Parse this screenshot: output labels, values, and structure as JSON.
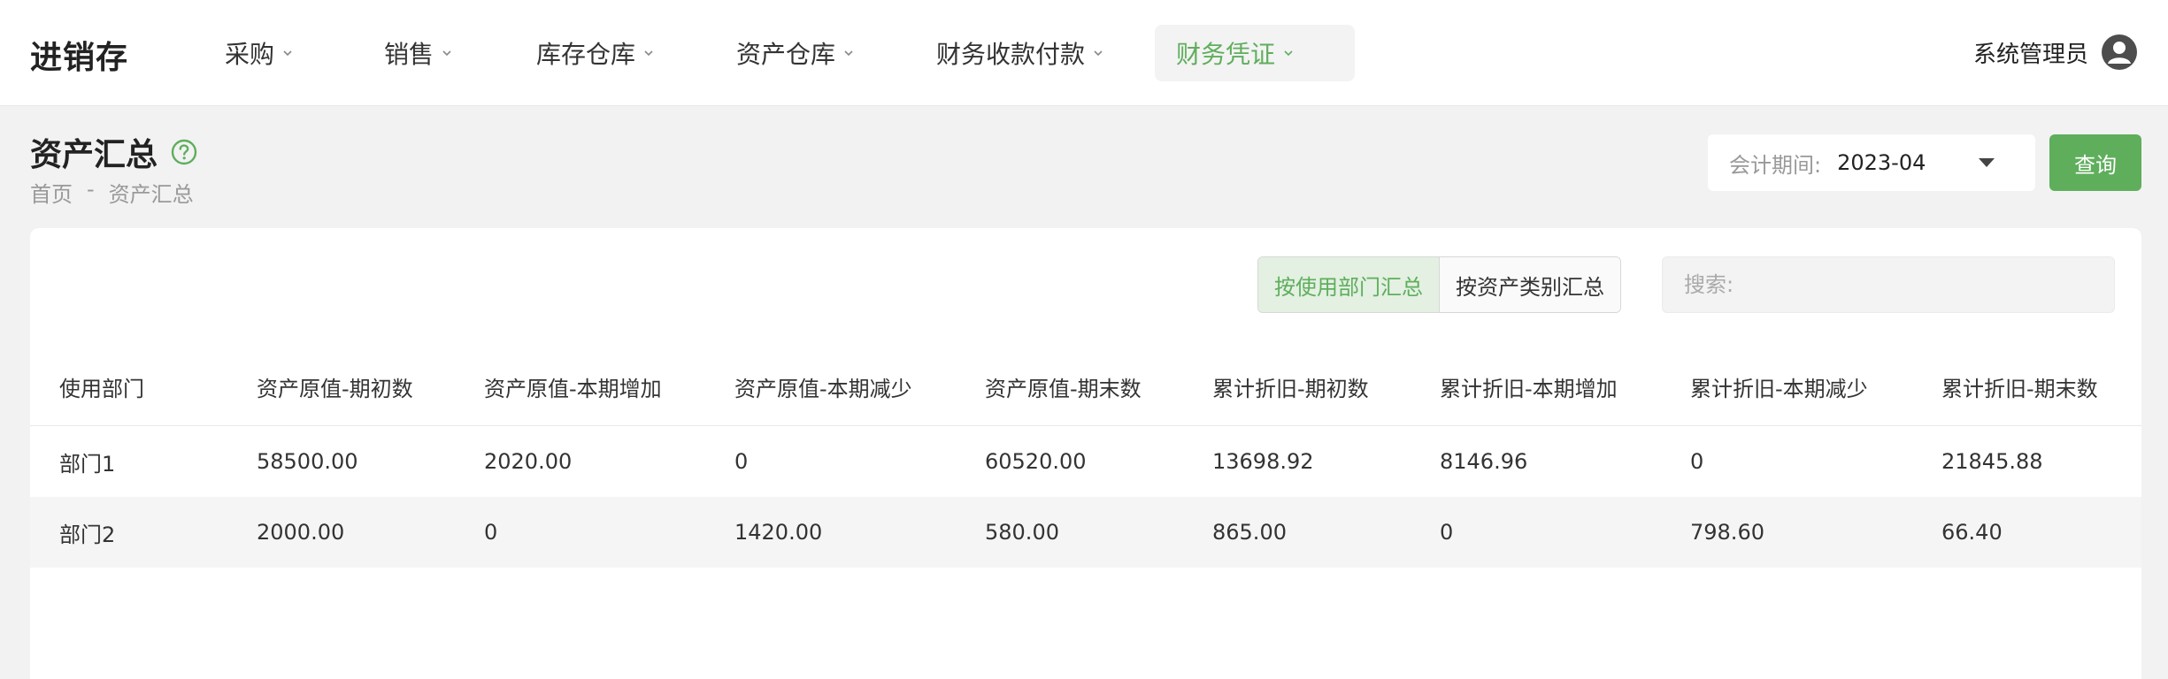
{
  "app": {
    "brand": "进销存"
  },
  "nav": {
    "items": [
      {
        "label": "采购"
      },
      {
        "label": "销售"
      },
      {
        "label": "库存仓库"
      },
      {
        "label": "资产仓库"
      },
      {
        "label": "财务收款付款"
      },
      {
        "label": "财务凭证"
      }
    ],
    "active_index": 5
  },
  "user": {
    "name": "系统管理员",
    "icon": "user-avatar-icon"
  },
  "page": {
    "title": "资产汇总",
    "help_icon": "question-circle-icon",
    "breadcrumb": {
      "home": "首页",
      "sep": "-",
      "current": "资产汇总"
    }
  },
  "filters": {
    "period_label": "会计期间:",
    "period_value": "2023-04",
    "query_label": "查询"
  },
  "toolbar": {
    "by_department": "按使用部门汇总",
    "by_category": "按资产类别汇总",
    "search_placeholder": "搜索:"
  },
  "table": {
    "columns": [
      "使用部门",
      "资产原值-期初数",
      "资产原值-本期增加",
      "资产原值-本期减少",
      "资产原值-期末数",
      "累计折旧-期初数",
      "累计折旧-本期增加",
      "累计折旧-本期减少",
      "累计折旧-期末数"
    ],
    "rows": [
      [
        "部门1",
        "58500.00",
        "2020.00",
        "0",
        "60520.00",
        "13698.92",
        "8146.96",
        "0",
        "21845.88"
      ],
      [
        "部门2",
        "2000.00",
        "0",
        "1420.00",
        "580.00",
        "865.00",
        "0",
        "798.60",
        "66.40"
      ]
    ]
  },
  "colors": {
    "accent": "#5fae5c",
    "background": "#f2f2f2"
  }
}
